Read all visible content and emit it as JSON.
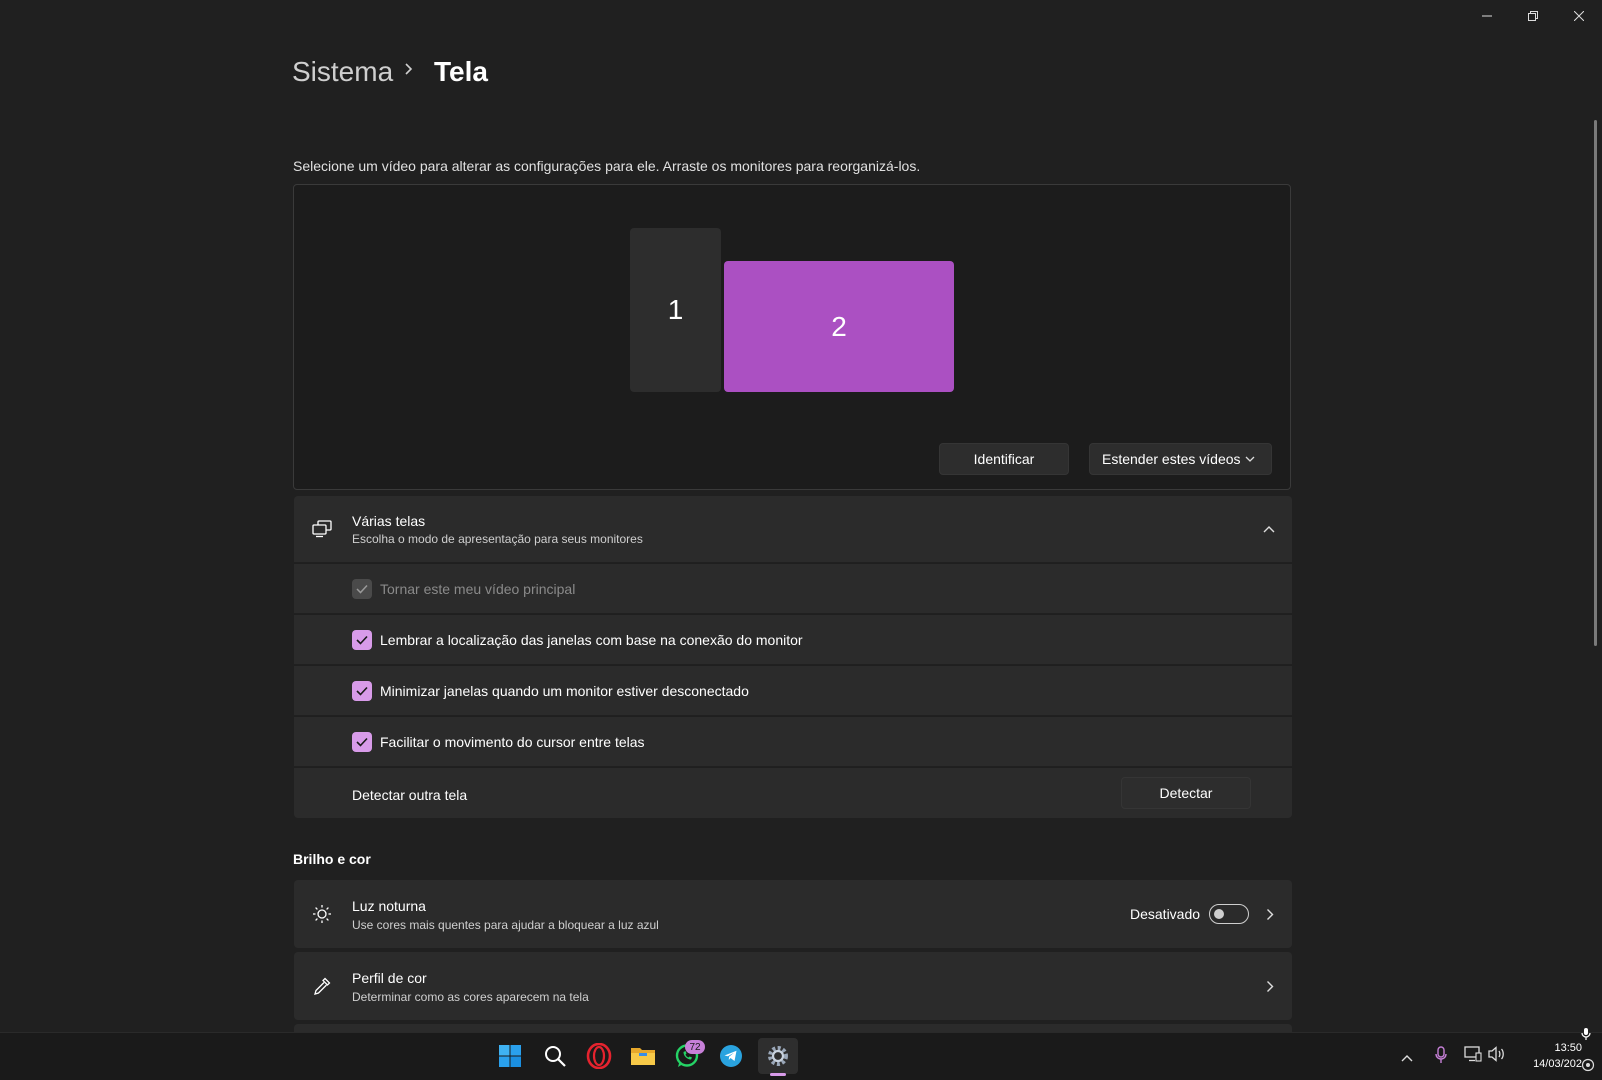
{
  "breadcrumb": {
    "parent": "Sistema",
    "current": "Tela"
  },
  "hint": "Selecione um vídeo para alterar as configurações para ele. Arraste os monitores para reorganizá-los.",
  "arrange": {
    "monitors": [
      {
        "label": "1",
        "selected": false
      },
      {
        "label": "2",
        "selected": true
      }
    ],
    "identify_label": "Identificar",
    "mode_label": "Estender estes vídeos"
  },
  "multi": {
    "title": "Várias telas",
    "subtitle": "Escolha o modo de apresentação para seus monitores",
    "options": [
      {
        "label": "Tornar este meu vídeo principal",
        "checked": true,
        "disabled": true
      },
      {
        "label": "Lembrar a localização das janelas com base na conexão do monitor",
        "checked": true,
        "disabled": false
      },
      {
        "label": "Minimizar janelas quando um monitor estiver desconectado",
        "checked": true,
        "disabled": false
      },
      {
        "label": "Facilitar o movimento do cursor entre telas",
        "checked": true,
        "disabled": false
      }
    ],
    "detect_label": "Detectar outra tela",
    "detect_button": "Detectar"
  },
  "brightness": {
    "section_title": "Brilho e cor",
    "night_light": {
      "title": "Luz noturna",
      "subtitle": "Use cores mais quentes para ajudar a bloquear a luz azul",
      "state": "Desativado",
      "on": false
    },
    "color_profile": {
      "title": "Perfil de cor",
      "subtitle": "Determinar como as cores aparecem na tela"
    }
  },
  "taskbar": {
    "icons": [
      "windows-start-icon",
      "search-icon",
      "opera-icon",
      "file-explorer-icon",
      "whatsapp-icon",
      "telegram-icon",
      "settings-icon"
    ],
    "whatsapp_badge": "72",
    "time": "13:50",
    "date": "14/03/202"
  },
  "colors": {
    "accent": "#d89be9",
    "monitor_selected": "#ab50c2",
    "background": "#202020",
    "card": "#2b2b2b"
  }
}
